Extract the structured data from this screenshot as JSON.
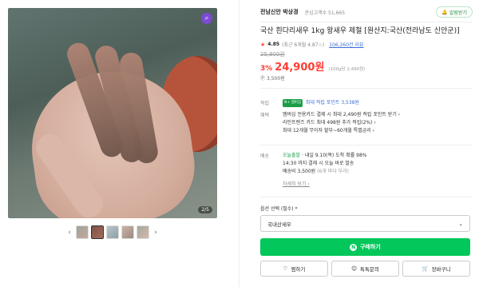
{
  "store": {
    "name": "전남신안 박상경",
    "fav_count": "관심고객수 51,665",
    "alarm_label": "알림받기"
  },
  "product": {
    "title": "국산 흰다리새우 1kg 왕새우 제철 [원산지:국산(전라남도 신안군)]",
    "rating_score": "4.85",
    "rating_meta": "(최근 6개월 4.87☆)",
    "review_link": "106,260건 리뷰",
    "original_price": "25,900원",
    "discount": "3%",
    "price": "24,900원",
    "unit_price": "(100g당 2,490원)",
    "points_small": "3,500원"
  },
  "benefits": {
    "points_label": "적립",
    "points_badge": "N+ 멤버십",
    "points_text": "최대 적립 포인트",
    "points_value": "3,538원",
    "benefit_label": "혜택",
    "benefit_lines": [
      "멤버십 전용카드 결제 시 최대 2,490원 적립 포인트 받기 ›",
      "라인프렌즈 카드 최대 498원 추가 적립(2%) ›",
      "최대 12개월 무이자 할부~60개월 특별금리 ›"
    ]
  },
  "delivery": {
    "label": "배송",
    "today_badge": "오늘출발",
    "arrival": "· 내일 9.10(목) 도착 확률 98%",
    "cutoff": "14:30 까지 결제 시 오늘 바로 발송",
    "fee": "배송비 3,500원",
    "fee_note": "(6개 마다 부과)",
    "more": "자세히 보기 ›"
  },
  "options": {
    "label": "옵션 선택 (필수) *",
    "selected": "국내산새우"
  },
  "actions": {
    "buy": "구매하기",
    "wish": "찜하기",
    "talk": "톡톡문의",
    "cart": "장바구니"
  },
  "gallery": {
    "counter": "2/5"
  }
}
